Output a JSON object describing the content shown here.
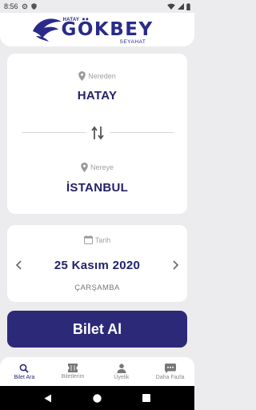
{
  "status_bar": {
    "time": "8:56",
    "icons": [
      "gear-icon",
      "shield-icon",
      "wifi-icon",
      "signal-icon",
      "battery-icon"
    ]
  },
  "header": {
    "logo_small": "HATAY",
    "logo_main": "GÖKBEY",
    "logo_sub": "SEYAHAT"
  },
  "route": {
    "from_label": "Nereden",
    "from_city": "HATAY",
    "to_label": "Nereye",
    "to_city": "İSTANBUL",
    "swap_icon": "swap-vertical-icon"
  },
  "date": {
    "label": "Tarih",
    "value": "25 Kasım 2020",
    "day": "ÇARŞAMBA"
  },
  "cta": {
    "label": "Bilet Al"
  },
  "bottom_nav": {
    "items": [
      {
        "label": "Bilet Ara",
        "icon": "search-icon",
        "active": true
      },
      {
        "label": "Biletlerim",
        "icon": "ticket-icon",
        "active": false
      },
      {
        "label": "Üyelik",
        "icon": "person-icon",
        "active": false
      },
      {
        "label": "Daha Fazla",
        "icon": "more-icon",
        "active": false
      }
    ]
  },
  "colors": {
    "primary": "#2c2a78",
    "city_text": "#22226b",
    "background": "#ececef"
  }
}
